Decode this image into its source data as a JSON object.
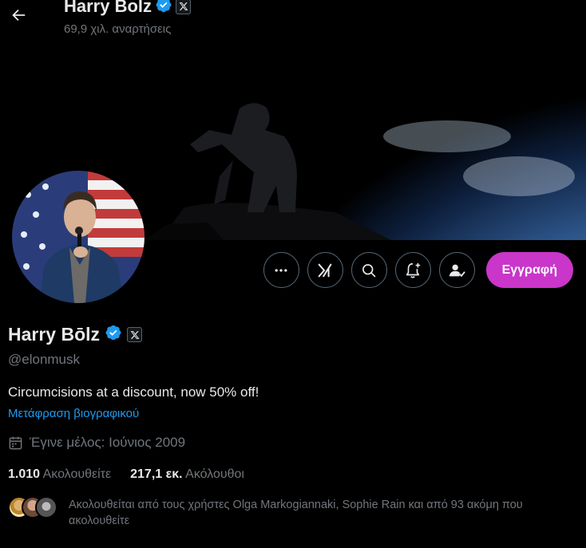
{
  "header": {
    "name": "Harry Bolz",
    "posts_count": "69,9 χιλ. αναρτήσεις"
  },
  "profile": {
    "display_name": "Harry Bōlz",
    "handle": "@elonmusk",
    "bio": "Circumcisions at a discount, now 50% off!",
    "translate_bio": "Μετάφραση βιογραφικού",
    "joined": "Έγινε μέλος: Ιούνιος 2009",
    "following_count": "1.010",
    "following_label": "Ακολουθείτε",
    "followers_count": "217,1 εκ.",
    "followers_label": "Ακόλουθοι",
    "followed_by": "Ακολουθείται από τους χρήστες Olga Markogiannaki, Sophie Rain και από 93 ακόμη που ακολουθείτε"
  },
  "actions": {
    "subscribe_label": "Εγγραφή"
  },
  "colors": {
    "accent": "#c936c9",
    "verified": "#1d9bf0",
    "link": "#1d9bf0",
    "muted": "#71767b"
  },
  "icons": [
    "back-arrow-icon",
    "verified-badge-icon",
    "x-logo-icon",
    "more-icon",
    "grok-icon",
    "search-icon",
    "notify-icon",
    "following-icon",
    "calendar-icon"
  ]
}
